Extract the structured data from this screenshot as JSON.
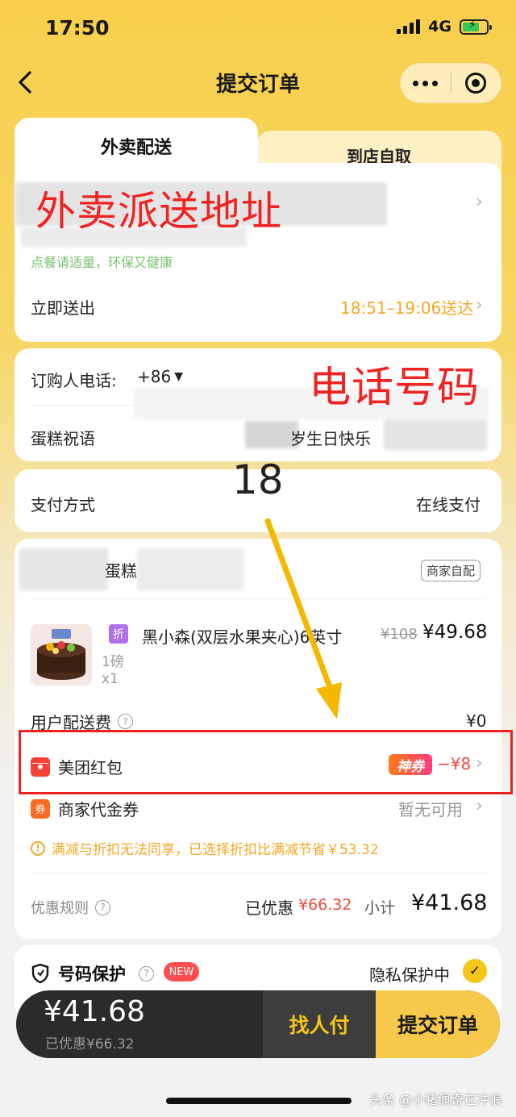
{
  "status_bar": {
    "time": "17:50",
    "network": "4G"
  },
  "nav": {
    "title": "提交订单"
  },
  "tabs": {
    "delivery": "外卖配送",
    "pickup": "到店自取"
  },
  "address": {
    "label": "外卖派送地址",
    "tip": "点餐请适量，环保又健康",
    "send_now": "立即送出",
    "delivery_window": "18:51–19:06送达"
  },
  "contact": {
    "phone_label": "订购人电话:",
    "country_code": "+86",
    "phone_annotation": "电话号码",
    "blessing_label": "蛋糕祝语",
    "blessing_text": "岁生日快乐"
  },
  "annotation_number": "18",
  "payment": {
    "label": "支付方式",
    "value": "在线支付"
  },
  "order": {
    "shop_name_suffix": "蛋糕",
    "delivery_tag": "商家自配",
    "item": {
      "badge": "折",
      "name": "黑小森(双层水果夹心)6英寸",
      "original_price": "¥108",
      "price": "¥49.68",
      "spec": "1磅",
      "qty": "x1"
    },
    "delivery_fee_label": "用户配送费",
    "delivery_fee": "¥0",
    "redpacket_label": "美团红包",
    "redpacket_badge": "神券",
    "redpacket_value": "−¥8",
    "coupon_icon": "券",
    "coupon_label": "商家代金券",
    "coupon_value": "暂无可用",
    "warning": "满减与折扣无法同享，已选择折扣比满减节省￥53.32",
    "rules_label": "优惠规则",
    "discounted_label": "已优惠",
    "discounted_value": "¥66.32",
    "subtotal_label": "小计",
    "subtotal_value": "¥41.68"
  },
  "protection": {
    "label": "号码保护",
    "new_badge": "NEW",
    "status": "隐私保护中"
  },
  "bottom": {
    "total": "¥41.68",
    "saved": "已优惠¥66.32",
    "pay_for_me": "找人付",
    "submit": "提交订单"
  },
  "watermark": "头条 @小猪佩奇在冲浪",
  "colors": {
    "brand_yellow": "#f7c94b",
    "annotation_red": "#f02222",
    "arrow_yellow": "#f5b800"
  }
}
